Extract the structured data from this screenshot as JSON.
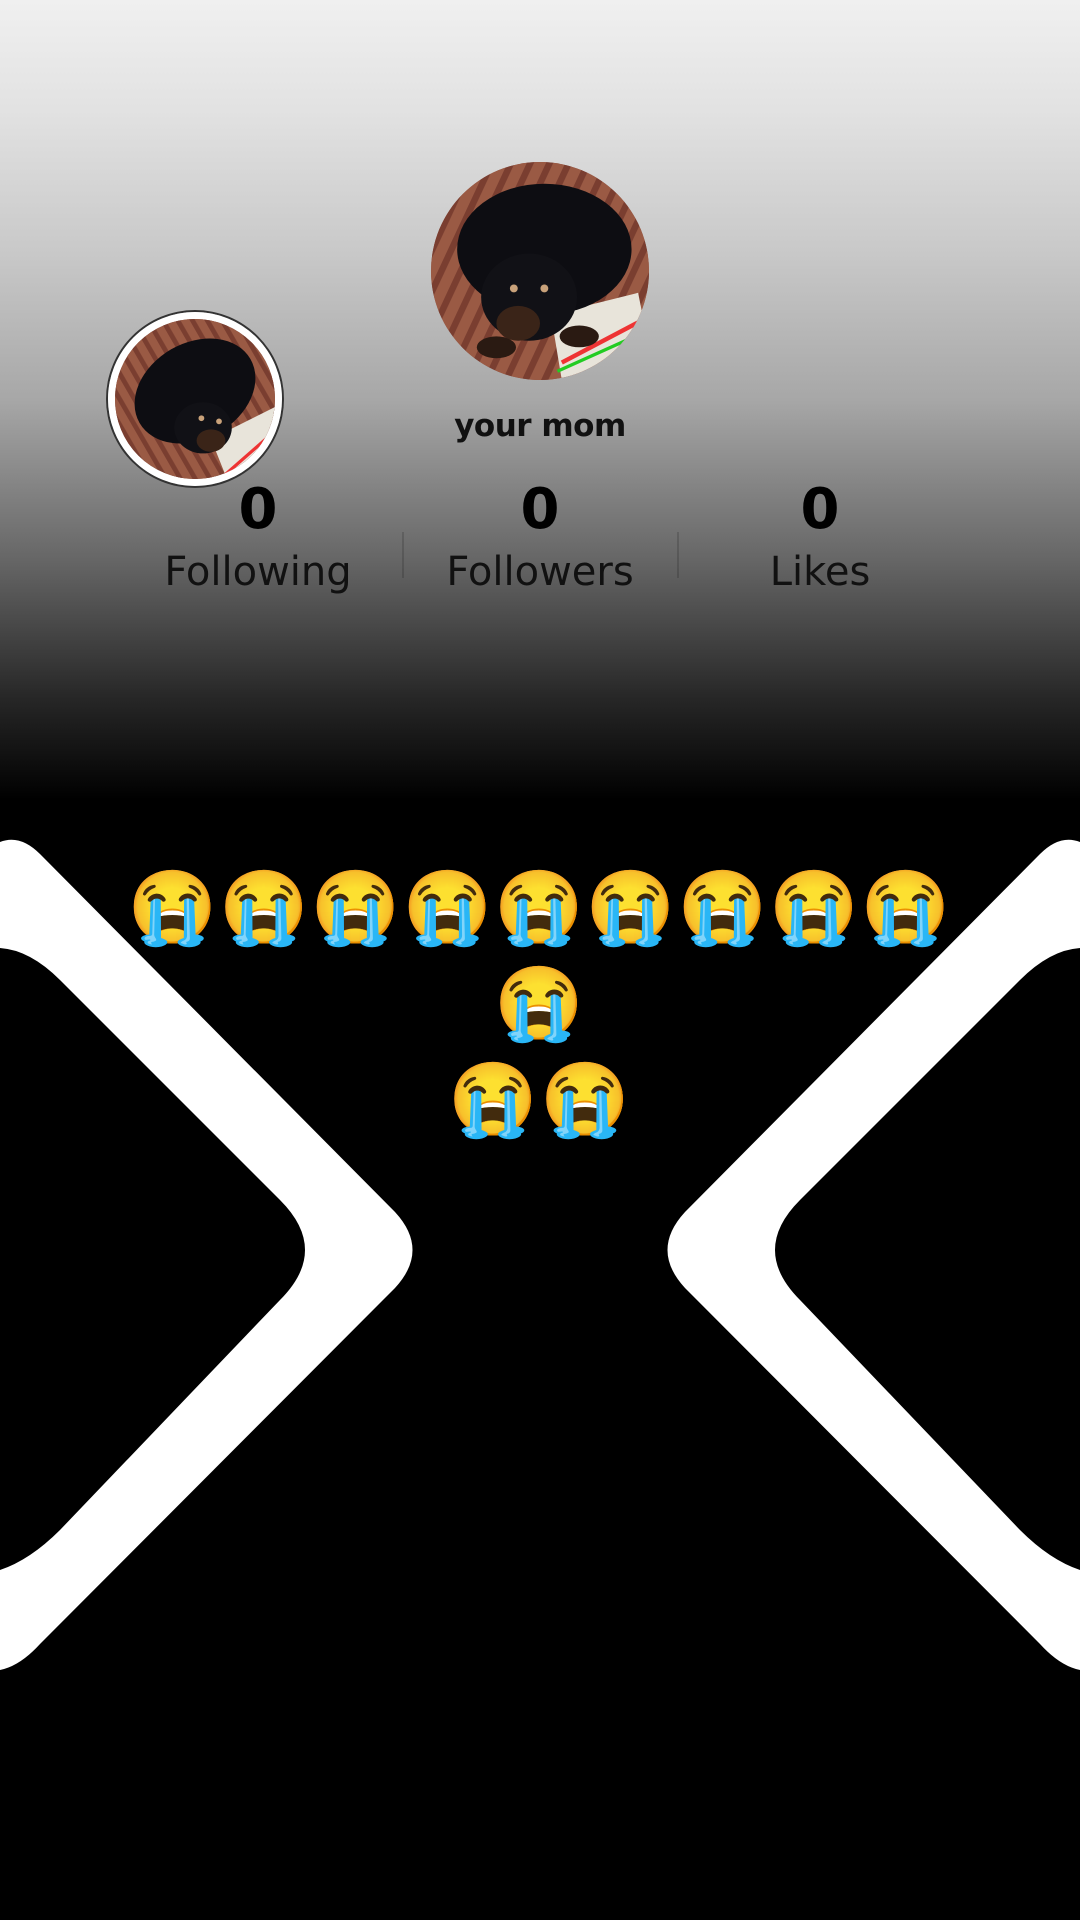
{
  "profile": {
    "username": "your mom",
    "avatar_main_icon": "dog-photo",
    "avatar_small_icon": "dog-photo"
  },
  "stats": {
    "following": {
      "value": "0",
      "label": "Following"
    },
    "followers": {
      "value": "0",
      "label": "Followers"
    },
    "likes": {
      "value": "0",
      "label": "Likes"
    }
  },
  "caption": {
    "emoji_line_1": "😭😭😭😭😭😭😭😭😭😭",
    "emoji_line_2": "😭😭"
  },
  "colors": {
    "top_background": "#f0f0f0",
    "bottom_background": "#000000",
    "shape_stroke": "#ffffff"
  }
}
